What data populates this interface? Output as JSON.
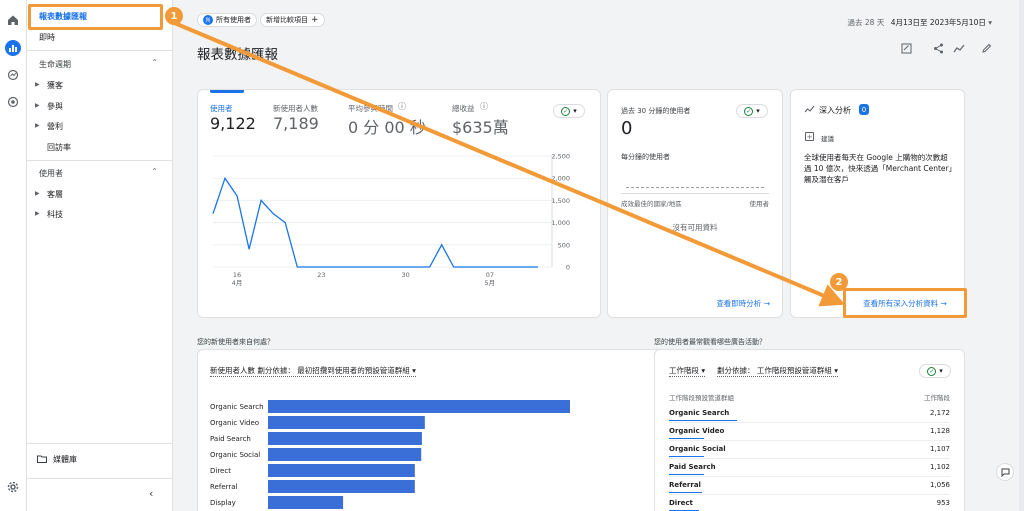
{
  "nav": {
    "selected_label": "報表數據匯報",
    "realtime_label": "即時",
    "lifecycle_label": "生命週期",
    "lifecycle_items": [
      "獲客",
      "參與",
      "營利"
    ],
    "retention_label": "回訪率",
    "user_label": "使用者",
    "user_items": [
      "客層",
      "科技"
    ],
    "library_label": "媒體庫"
  },
  "header": {
    "segment_badge": "所",
    "segment_label": "所有使用者",
    "compare_label": "新增比較項目",
    "date_label": "過去 28 天",
    "date_range": "4月13日至 2023年5月10日",
    "page_title": "報表數據匯報"
  },
  "overview": {
    "metrics": [
      {
        "label": "使用者",
        "value": "9,122"
      },
      {
        "label": "新使用者人數",
        "value": "7,189"
      },
      {
        "label": "平均參與時間",
        "value": "0 分 00 秒"
      },
      {
        "label": "總收益",
        "value": "$635萬"
      }
    ],
    "yticks": [
      "2,500",
      "2,000",
      "1,500",
      "1,000",
      "500",
      "0"
    ],
    "xticks": [
      {
        "day": "16",
        "month": "4月"
      },
      {
        "day": "23",
        "month": ""
      },
      {
        "day": "30",
        "month": ""
      },
      {
        "day": "07",
        "month": "5月"
      }
    ]
  },
  "chart_data": {
    "type": "line",
    "x": [
      1,
      2,
      3,
      4,
      5,
      6,
      7,
      8,
      9,
      10,
      11,
      12,
      13,
      14,
      15,
      16,
      17,
      18,
      19,
      20,
      21,
      22,
      23,
      24,
      25,
      26,
      27,
      28
    ],
    "values": [
      1200,
      2000,
      1600,
      400,
      1500,
      1200,
      1000,
      0,
      0,
      0,
      0,
      0,
      0,
      0,
      0,
      0,
      0,
      0,
      0,
      500,
      0,
      0,
      0,
      0,
      0,
      0,
      0,
      0
    ],
    "ylim": [
      0,
      2500
    ]
  },
  "realtime": {
    "title": "過去 30 分鐘的使用者",
    "value": "0",
    "per_minute": "每分鐘的使用者",
    "col_country": "成效最佳的國家/地區",
    "col_users": "使用者",
    "no_data": "沒有可用資料",
    "link": "查看即時分析"
  },
  "insights": {
    "title": "深入分析",
    "count": "0",
    "tag": "建議",
    "text": "全球使用者每天在 Google 上購物的次數超過 10 億次，快來透過「Merchant Center」觸及潛在客戶",
    "link": "查看所有深入分析資料"
  },
  "acq": {
    "question": "您的新使用者來自何處？",
    "dropdown": "新使用者人數 劃分依據： 最初招攬到使用者的預設管道群組",
    "bars": [
      {
        "label": "Organic Search",
        "value": 2172
      },
      {
        "label": "Organic Video",
        "value": 1128
      },
      {
        "label": "Paid Search",
        "value": 1107
      },
      {
        "label": "Organic Social",
        "value": 1102
      },
      {
        "label": "Direct",
        "value": 1056
      },
      {
        "label": "Referral",
        "value": 1056
      },
      {
        "label": "Display",
        "value": 540
      }
    ]
  },
  "session": {
    "question": "您的使用者最常觀看哪些廣告活動？",
    "dropdown1": "工作階段",
    "dropdown2": "劃分依據： 工作階段預設管道群組",
    "col1": "工作階段預設管道群組",
    "col2": "工作階段",
    "rows": [
      {
        "k": "Organic Search",
        "v": "2,172",
        "n": 2172
      },
      {
        "k": "Organic Video",
        "v": "1,128",
        "n": 1128
      },
      {
        "k": "Organic Social",
        "v": "1,107",
        "n": 1107
      },
      {
        "k": "Paid Search",
        "v": "1,102",
        "n": 1102
      },
      {
        "k": "Referral",
        "v": "1,056",
        "n": 1056
      },
      {
        "k": "Direct",
        "v": "953",
        "n": 953
      }
    ]
  },
  "annotations": {
    "badge1": "1",
    "badge2": "2"
  },
  "colors": {
    "accent": "#1a73e8",
    "highlight": "#f29a38"
  }
}
